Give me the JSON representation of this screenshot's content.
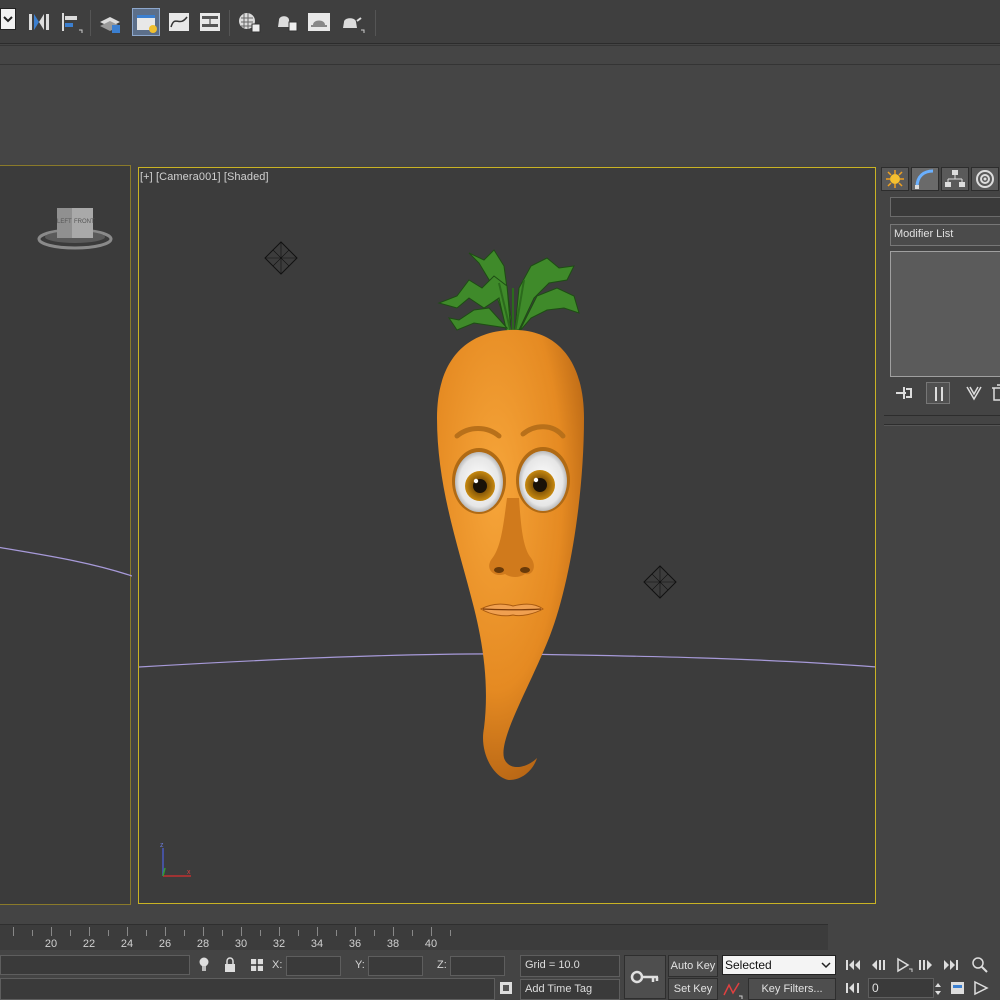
{
  "viewport": {
    "label": "[+] [Camera001] [Shaded]",
    "viewcube_face_left": "LEFT",
    "viewcube_face_front": "FRONT",
    "axis_z": "z",
    "axis_x": "x"
  },
  "command_panel": {
    "modifier_list": "Modifier List",
    "tabs": [
      "create-icon",
      "modify-icon",
      "hierarchy-icon",
      "motion-icon"
    ]
  },
  "timeline": {
    "ticks": [
      "20",
      "22",
      "24",
      "26",
      "28",
      "30",
      "32",
      "34",
      "36",
      "38",
      "40"
    ]
  },
  "status": {
    "x_label": "X:",
    "y_label": "Y:",
    "z_label": "Z:",
    "grid": "Grid = 10.0",
    "add_time_tag": "Add Time Tag",
    "auto_key": "Auto Key",
    "set_key": "Set Key",
    "selected": "Selected",
    "key_filters": "Key Filters...",
    "frame": "0"
  },
  "colors": {
    "active_viewport_border": "#c9b324",
    "carrot": "#e8932a",
    "leaves": "#3f8a2a"
  }
}
